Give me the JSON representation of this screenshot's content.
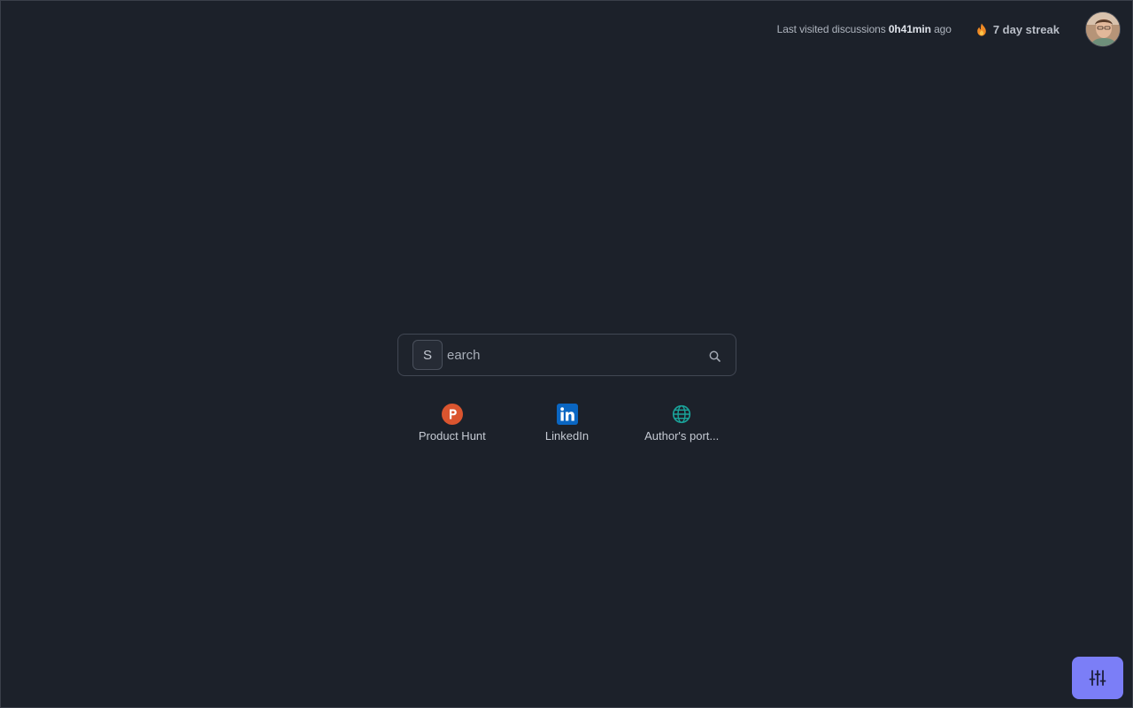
{
  "header": {
    "last_visited_prefix": "Last visited discussions ",
    "last_visited_time": "0h41min",
    "last_visited_suffix": " ago",
    "streak_label": "7 day streak",
    "streak_icon": "flame-icon",
    "avatar_icon": "user-avatar"
  },
  "search": {
    "key_letter": "S",
    "placeholder_rest": "earch",
    "icon": "search-icon"
  },
  "shortcuts": [
    {
      "label": "Product Hunt",
      "icon": "product-hunt-icon",
      "color": "#da552f"
    },
    {
      "label": "LinkedIn",
      "icon": "linkedin-icon",
      "color": "#0a66c2"
    },
    {
      "label": "Author's port...",
      "icon": "globe-icon",
      "color": "#1aa39a"
    }
  ],
  "fab": {
    "icon": "sliders-icon",
    "color": "#7b7ef7"
  },
  "colors": {
    "background": "#1c212a",
    "accent": "#7b7ef7"
  }
}
